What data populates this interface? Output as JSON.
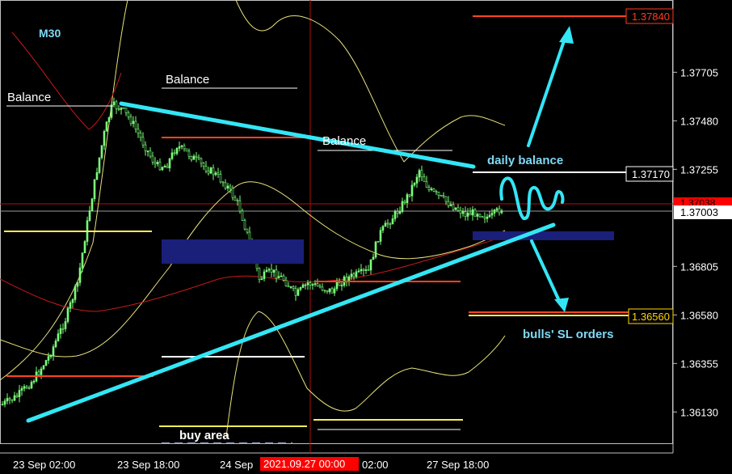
{
  "chart_data": {
    "type": "line",
    "timeframe": "M30",
    "y_axis": {
      "min": 1.35985,
      "max": 1.3804,
      "ticks": [
        "1.37705",
        "1.37480",
        "1.37255",
        "1.36805",
        "1.36580",
        "1.36355",
        "1.36130"
      ]
    },
    "x_ticks": [
      "23 Sep 02:00",
      "23 Sep 18:00",
      "24 Sep",
      "02:00",
      "27 Sep 18:00"
    ],
    "cursor_time_label": "2021.09.27 00:00",
    "price_badges": [
      {
        "text": "1.37840",
        "color": "#ff3b1a"
      },
      {
        "text": "1.37170",
        "color": "#ffffff"
      },
      {
        "text": "1.37038",
        "color": "#ff0000"
      },
      {
        "text": "1.37003",
        "color": "#ffffff"
      },
      {
        "text": "1.36560",
        "color": "#ffd700"
      }
    ],
    "annotations": {
      "balance_labels": [
        "Balance",
        "Balance",
        "Balance"
      ],
      "daily_balance": "daily balance",
      "bulls_sl": "bulls' SL orders",
      "buy_area": "buy area"
    },
    "colors": {
      "candles": "#7bff7b",
      "trendline": "#33e6f5",
      "zone": "#1a1f7a",
      "bollinger": "#e8e27a",
      "ma": "#c41a1a",
      "level_red": "#ff4422",
      "level_yellow": "#ffee55",
      "level_white": "#ffffff"
    }
  }
}
